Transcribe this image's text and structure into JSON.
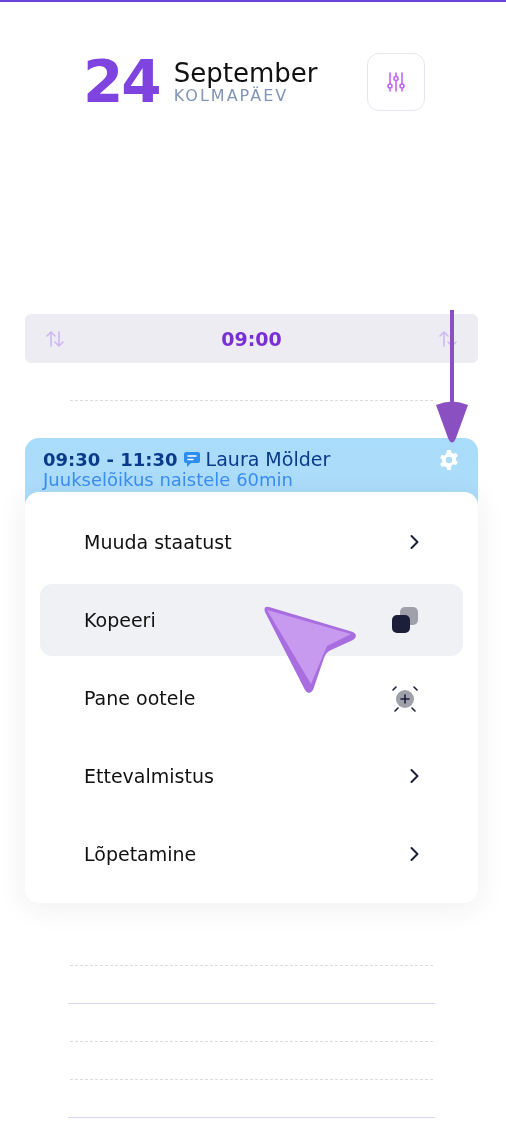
{
  "header": {
    "day": "24",
    "month": "September",
    "weekday": "KOLMAPÄEV"
  },
  "time_bar": {
    "time": "09:00"
  },
  "appointment": {
    "time": "09:30 - 11:30",
    "client": "Laura Mölder",
    "service": "Juukselõikus naistele 60min",
    "has_comment": true
  },
  "menu": {
    "items": [
      {
        "label": "Muuda staatust",
        "kind": "submenu",
        "selected": false
      },
      {
        "label": "Kopeeri",
        "kind": "copy",
        "selected": true
      },
      {
        "label": "Pane ootele",
        "kind": "hold",
        "selected": false
      },
      {
        "label": "Ettevalmistus",
        "kind": "submenu",
        "selected": false
      },
      {
        "label": "Lõpetamine",
        "kind": "submenu",
        "selected": false
      }
    ]
  }
}
